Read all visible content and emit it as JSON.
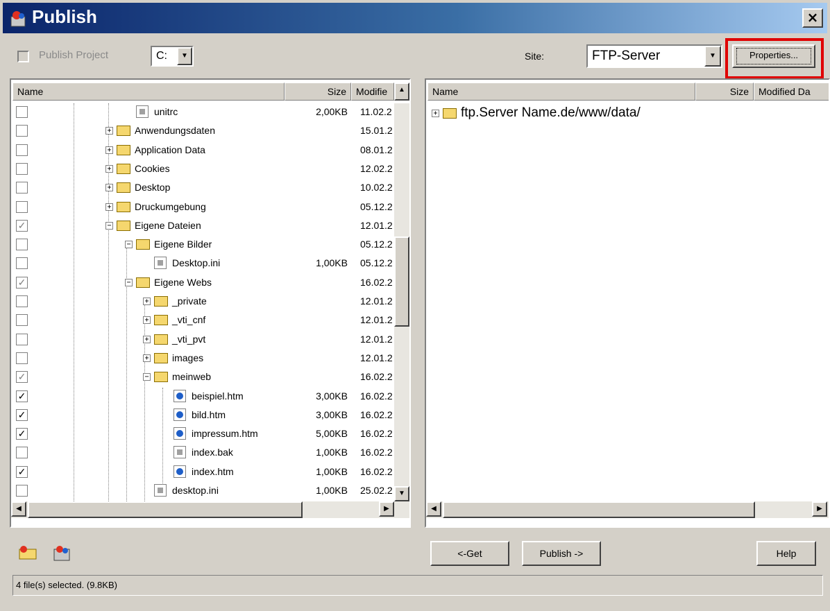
{
  "window": {
    "title": "Publish",
    "close_label": "×"
  },
  "toolbar": {
    "publish_project_label": "Publish Project",
    "drive_value": "C:",
    "site_label": "Site:",
    "site_value": "FTP-Server",
    "properties_label": "Properties..."
  },
  "left_pane": {
    "columns": {
      "name": "Name",
      "size": "Size",
      "modified": "Modifie"
    },
    "rows": [
      {
        "label": "unitrc",
        "size": "2,00KB",
        "modified": "11.02.2",
        "checked": false
      },
      {
        "label": "Anwendungsdaten",
        "size": "",
        "modified": "15.01.2",
        "checked": false
      },
      {
        "label": "Application Data",
        "size": "",
        "modified": "08.01.2",
        "checked": false
      },
      {
        "label": "Cookies",
        "size": "",
        "modified": "12.02.2",
        "checked": false
      },
      {
        "label": "Desktop",
        "size": "",
        "modified": "10.02.2",
        "checked": false
      },
      {
        "label": "Druckumgebung",
        "size": "",
        "modified": "05.12.2",
        "checked": false
      },
      {
        "label": "Eigene Dateien",
        "size": "",
        "modified": "12.01.2",
        "checked": "grey"
      },
      {
        "label": "Eigene Bilder",
        "size": "",
        "modified": "05.12.2",
        "checked": false
      },
      {
        "label": "Desktop.ini",
        "size": "1,00KB",
        "modified": "05.12.2",
        "checked": false
      },
      {
        "label": "Eigene Webs",
        "size": "",
        "modified": "16.02.2",
        "checked": "grey"
      },
      {
        "label": "_private",
        "size": "",
        "modified": "12.01.2",
        "checked": false
      },
      {
        "label": "_vti_cnf",
        "size": "",
        "modified": "12.01.2",
        "checked": false
      },
      {
        "label": "_vti_pvt",
        "size": "",
        "modified": "12.01.2",
        "checked": false
      },
      {
        "label": "images",
        "size": "",
        "modified": "12.01.2",
        "checked": false
      },
      {
        "label": "meinweb",
        "size": "",
        "modified": "16.02.2",
        "checked": "grey"
      },
      {
        "label": "beispiel.htm",
        "size": "3,00KB",
        "modified": "16.02.2",
        "checked": true
      },
      {
        "label": "bild.htm",
        "size": "3,00KB",
        "modified": "16.02.2",
        "checked": true
      },
      {
        "label": "impressum.htm",
        "size": "5,00KB",
        "modified": "16.02.2",
        "checked": true
      },
      {
        "label": "index.bak",
        "size": "1,00KB",
        "modified": "16.02.2",
        "checked": false
      },
      {
        "label": "index.htm",
        "size": "1,00KB",
        "modified": "16.02.2",
        "checked": true
      },
      {
        "label": "desktop.ini",
        "size": "1,00KB",
        "modified": "25.02.2",
        "checked": false
      }
    ]
  },
  "right_pane": {
    "columns": {
      "name": "Name",
      "size": "Size",
      "modified": "Modified Da"
    },
    "root": "ftp.Server Name.de/www/data/"
  },
  "buttons": {
    "get": "<-Get",
    "publish": "Publish ->",
    "help": "Help"
  },
  "status": {
    "text": "4 file(s) selected. (9.8KB)"
  },
  "icons": [
    "publish-app-icon",
    "new-folder-icon",
    "site-manager-icon",
    "folder-icon",
    "file-icon",
    "html-file-icon"
  ]
}
